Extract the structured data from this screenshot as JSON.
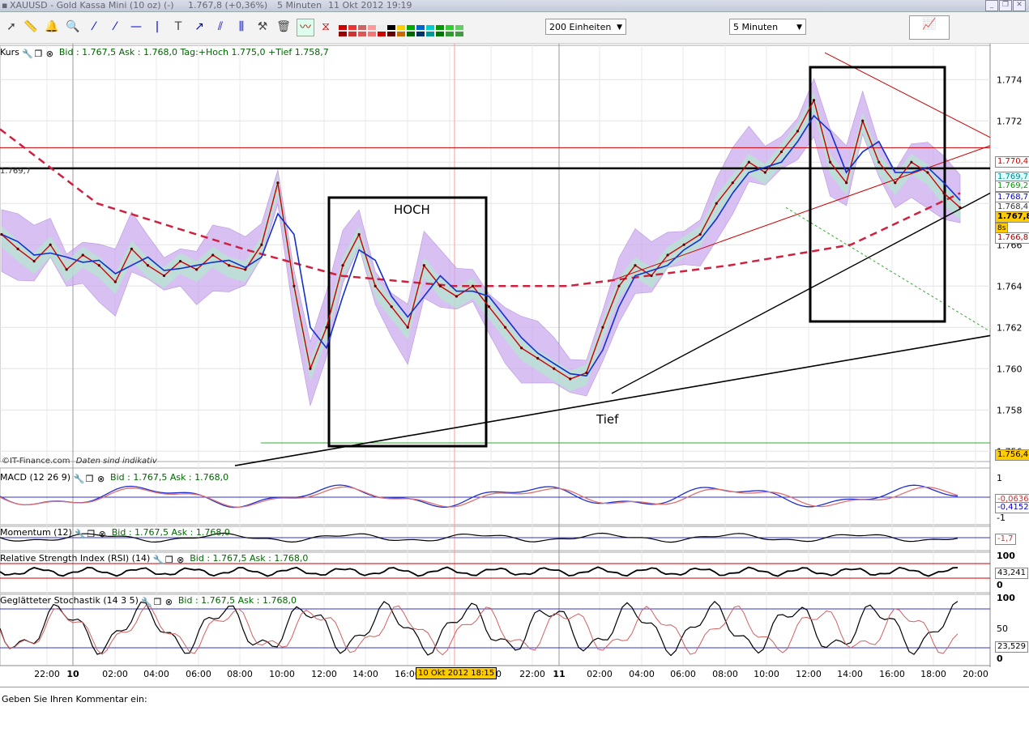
{
  "window": {
    "title": "XAUUSD - Gold Kassa Mini (10 oz) (-)",
    "price": "1.767,8 (+0,36%)",
    "interval": "5 Minuten",
    "datetime": "11 Okt 2012 19:19"
  },
  "toolbar": {
    "units_select": "200 Einheiten",
    "interval_select": "5 Minuten"
  },
  "main_panel": {
    "name": "Kurs",
    "info": "Bid : 1.767,5 Ask : 1.768,0 Tag:+Hoch 1.775,0 +Tief 1.758,7",
    "left_level": "1.769,7",
    "source": "IT-Finance.com",
    "disclaimer": "Daten sind indikativ",
    "annotation_high": "HOCH",
    "annotation_low": "Tief",
    "badges": [
      "1.770,4",
      "1.769,7",
      "1.769,2",
      "1.768,7",
      "1.768,4",
      "1.767,8",
      "8s",
      "1.766,8",
      "1.756,4"
    ]
  },
  "macd_panel": {
    "name": "MACD (12 26 9)",
    "info": "Bid : 1.767,5 Ask : 1.768,0",
    "badges": [
      "-0,0636",
      "-0,4152"
    ],
    "axis": [
      "1",
      "-1"
    ]
  },
  "momentum_panel": {
    "name": "Momentum (12)",
    "info": "Bid : 1.767,5 Ask : 1.768,0",
    "badge": "-1,7"
  },
  "rsi_panel": {
    "name": "Relative Strength Index (RSI) (14)",
    "info": "Bid : 1.767,5 Ask : 1.768,0",
    "badge": "43,241",
    "axis": [
      "100",
      "0"
    ]
  },
  "stoch_panel": {
    "name": "Geglätteter Stochastik (14 3 5)",
    "info": "Bid : 1.767,5 Ask : 1.768,0",
    "badge": "23,529",
    "axis": [
      "100",
      "50",
      "0"
    ]
  },
  "time_axis": {
    "highlight": "10 Okt 2012 18:15",
    "labels": [
      "22:00",
      "10",
      "02:00",
      "04:00",
      "06:00",
      "08:00",
      "10:00",
      "12:00",
      "14:00",
      "16:00",
      "00",
      "22:00",
      "11",
      "02:00",
      "04:00",
      "06:00",
      "08:00",
      "10:00",
      "12:00",
      "14:00",
      "16:00",
      "18:00",
      "20:00"
    ]
  },
  "comment_prompt": "Geben Sie Ihren Kommentar ein:",
  "chart_data": {
    "type": "line",
    "title": "XAUUSD - Gold Kassa Mini (10 oz)",
    "xlabel": "",
    "ylabel": "",
    "y_ticks": [
      "1.774",
      "1.772",
      "1.770",
      "1.768",
      "1.766",
      "1.764",
      "1.762",
      "1.760",
      "1.758",
      "1.756"
    ],
    "ylim": [
      1.7555,
      1.7755
    ],
    "x_ticks": [
      "22:00",
      "10",
      "02:00",
      "04:00",
      "06:00",
      "08:00",
      "10:00",
      "12:00",
      "14:00",
      "16:00",
      "18:00",
      "20:00",
      "22:00",
      "11",
      "02:00",
      "04:00",
      "06:00",
      "08:00",
      "10:00",
      "12:00",
      "14:00",
      "16:00",
      "18:00",
      "20:00"
    ],
    "series": [
      {
        "values": [
          1.7665,
          1.7658,
          1.7652,
          1.766,
          1.7648,
          1.7655,
          1.765,
          1.7642,
          1.7658,
          1.765,
          1.7645,
          1.7652,
          1.7648,
          1.7655,
          1.765,
          1.7648,
          1.766,
          1.769,
          1.764,
          1.76,
          1.762,
          1.765,
          1.7665,
          1.764,
          1.763,
          1.762,
          1.765,
          1.764,
          1.7635,
          1.764,
          1.763,
          1.762,
          1.761,
          1.7605,
          1.76,
          1.7595,
          1.7598,
          1.762,
          1.764,
          1.765,
          1.7645,
          1.7655,
          1.766,
          1.7665,
          1.768,
          1.769,
          1.77,
          1.7695,
          1.7705,
          1.7715,
          1.773,
          1.77,
          1.769,
          1.772,
          1.77,
          1.769,
          1.77,
          1.7695,
          1.7685,
          1.7678
        ]
      }
    ],
    "levels": [
      1.7697,
      1.7564
    ],
    "annotations": [
      "HOCH",
      "Tief"
    ]
  }
}
